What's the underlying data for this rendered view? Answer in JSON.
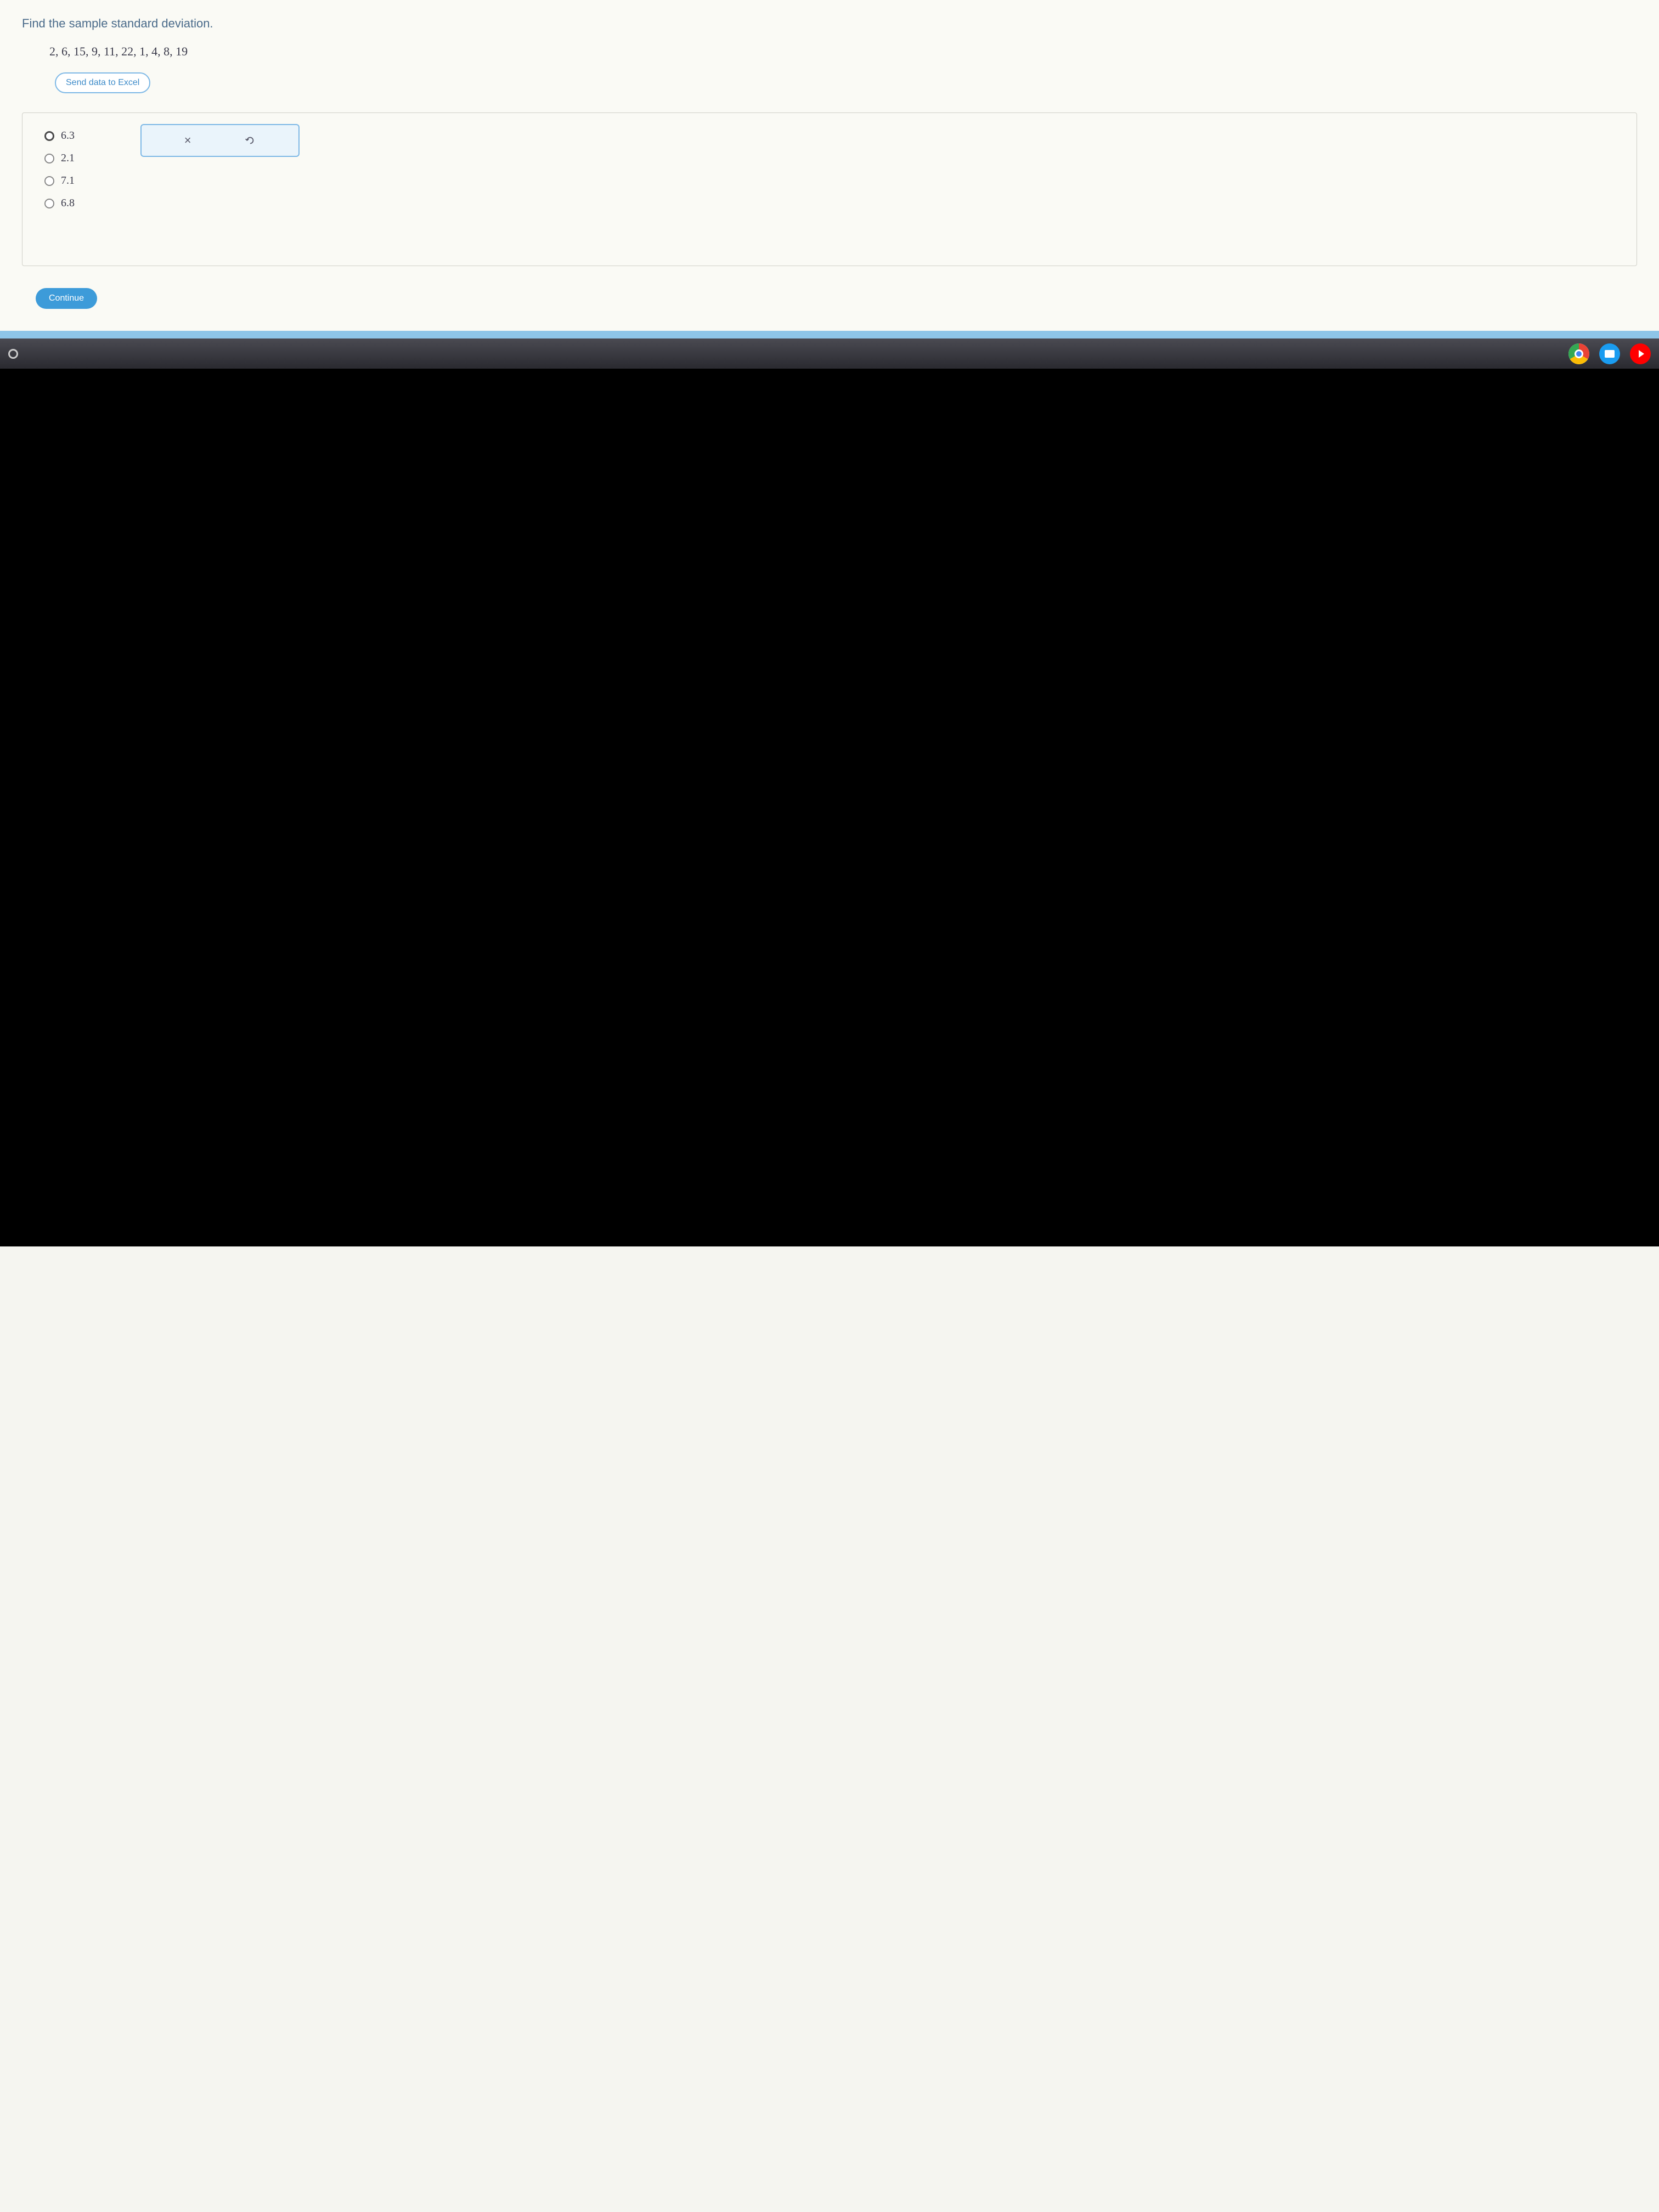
{
  "question": {
    "prompt": "Find the sample standard deviation.",
    "data_values": "2, 6, 15, 9, 11, 22, 1, 4, 8, 19",
    "send_data_label": "Send data to Excel"
  },
  "options": [
    {
      "value": "6.3",
      "selected": true
    },
    {
      "value": "2.1",
      "selected": false
    },
    {
      "value": "7.1",
      "selected": false
    },
    {
      "value": "6.8",
      "selected": false
    }
  ],
  "feedback": {
    "clear_icon": "×",
    "undo_icon": "undo"
  },
  "continue_label": "Continue",
  "taskbar": {
    "apps": [
      "chrome",
      "files",
      "youtube"
    ]
  }
}
